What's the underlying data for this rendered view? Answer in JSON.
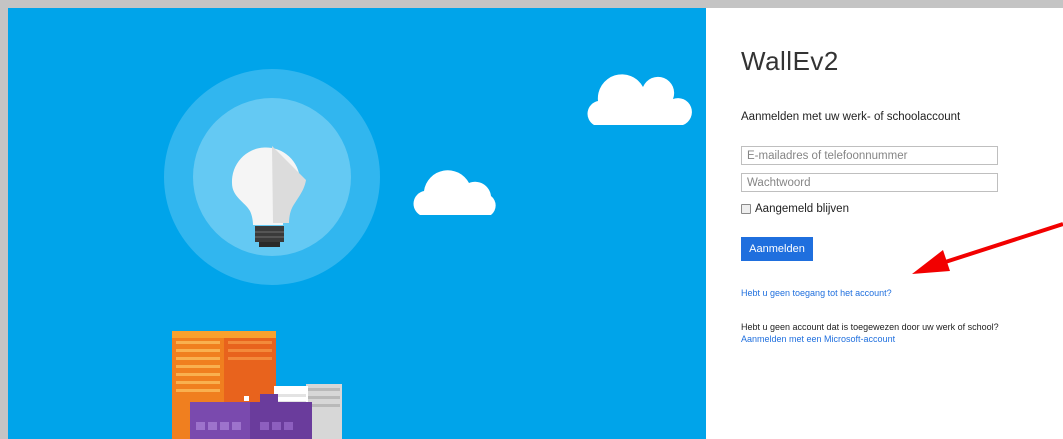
{
  "colors": {
    "hero_background": "#00a4ea",
    "accent": "#1f6fde",
    "annotation_arrow": "#f20000"
  },
  "hero": {
    "illustration_icons": [
      "lightbulb-icon",
      "cloud-icon",
      "building-icon"
    ]
  },
  "signin": {
    "app_name": "WallEv2",
    "subtitle": "Aanmelden met uw werk- of schoolaccount",
    "email_placeholder": "E-mailadres of telefoonnummer",
    "password_placeholder": "Wachtwoord",
    "remember_label": "Aangemeld blijven",
    "remember_checked": false,
    "submit_label": "Aanmelden",
    "forgot_link": "Hebt u geen toegang tot het account?",
    "no_account_text": "Hebt u geen account dat is toegewezen door uw werk of school?",
    "microsoft_account_link": "Aanmelden met een Microsoft-account"
  }
}
